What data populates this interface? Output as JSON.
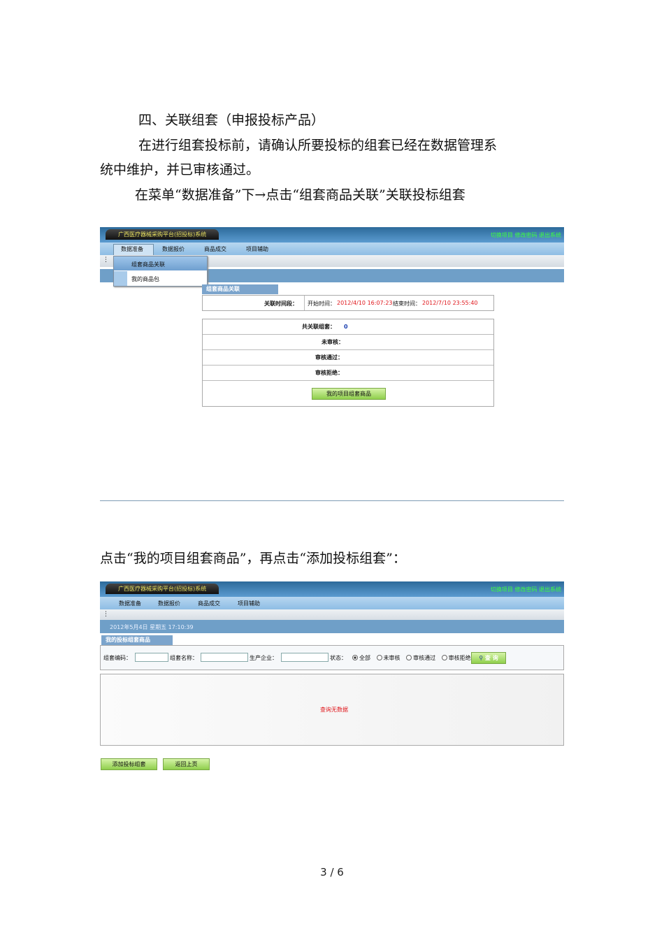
{
  "doc": {
    "para1": "四、关联组套（申报投标产品）",
    "para2a": "在进行组套投标前，请确认所要投标的组套已经在数据管理系",
    "para2b": "统中维护，并已审核通过。",
    "para3": "在菜单“数据准备”下→点击“组套商品关联”关联投标组套",
    "para4": "点击“我的项目组套商品”，再点击“添加投标组套”：",
    "page_number": "3 / 6"
  },
  "app": {
    "title": "广西医疗器械采购平台(招投标)系统",
    "top_links": "切换项目  修改密码  退出系统",
    "menu": [
      "数据准备",
      "数据报价",
      "商品成交",
      "项目辅助"
    ]
  },
  "shot1": {
    "dropdown": [
      "组套商品关联",
      "我的商品包"
    ],
    "panel_title": "组套商品关联",
    "time_label": "关联时间段：",
    "start_label": "开始时间：",
    "start_value": "2012/4/10 16:07:23",
    "end_label": "结束时间：",
    "end_value": "2012/7/10 23:55:40",
    "total_label": "共关联组套：",
    "total_value": "0",
    "pending_label": "未审核：",
    "approved_label": "审核通过：",
    "rejected_label": "审核拒绝：",
    "button": "我的项目组套商品"
  },
  "shot2": {
    "date": "2012年5月4日 星期五  17:10:39",
    "panel_title": "我的投标组套商品",
    "code_label": "组套编码：",
    "name_label": "组套名称：",
    "maker_label": "生产企业：",
    "status_label": "状态：",
    "status_options": [
      "全部",
      "未审核",
      "审核通过",
      "审核拒绝"
    ],
    "query_button": "查 询",
    "empty_text": "查询无数据",
    "add_button": "添加投标组套",
    "back_button": "返回上页"
  },
  "colors": {
    "red_text": "#e0161b",
    "blue_value": "#1a3fb0",
    "green": "#8fcf4c"
  }
}
